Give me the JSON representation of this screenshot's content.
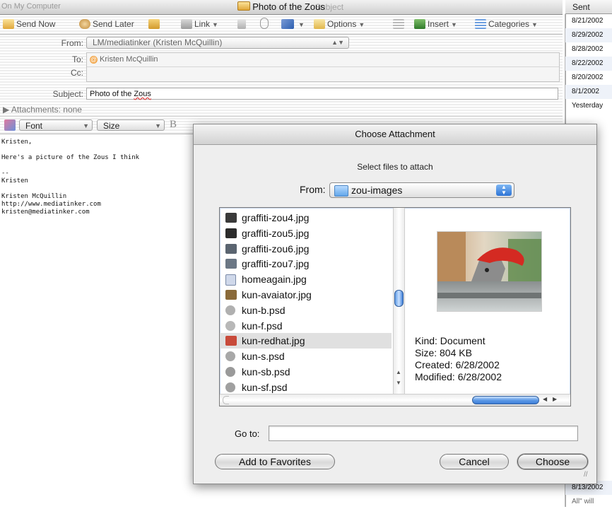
{
  "window": {
    "title": "Photo of the Zous",
    "ghost_left": "On My Computer",
    "ghost_right": "Subject"
  },
  "toolbar": {
    "send_now": "Send Now",
    "send_later": "Send Later",
    "link": "Link",
    "options": "Options",
    "insert": "Insert",
    "categories": "Categories"
  },
  "header": {
    "from_label": "From:",
    "from_value": "LM/mediatinker (Kristen McQuillin)",
    "to_label": "To:",
    "to_value": "Kristen McQuillin",
    "cc_label": "Cc:",
    "subject_label": "Subject:",
    "subject_value_pre": "Photo of the ",
    "subject_value_word": "Zous",
    "attachments_label": "▶ Attachments:",
    "attachments_value": "none"
  },
  "format_bar": {
    "font": "Font",
    "size": "Size",
    "bold": "B"
  },
  "message_body": "Kristen,\n\nHere's a picture of the Zous I think\n\n--\nKristen\n\nKristen McQuillin\nhttp://www.mediatinker.com\nkristen@mediatinker.com",
  "sent_column": {
    "header": "Sent",
    "dates": [
      "8/21/2002",
      "8/29/2002",
      "8/28/2002",
      "8/22/2002",
      "8/20/2002",
      "8/1/2002",
      "Yesterday"
    ],
    "bottom_date": "8/13/2002",
    "bottom_text": "All\" will"
  },
  "dialog": {
    "title": "Choose Attachment",
    "prompt": "Select files to attach",
    "from_label": "From:",
    "folder": "zou-images",
    "files": [
      {
        "name": "graffiti-zou4.jpg",
        "icon": "photo-icon",
        "color": "#3a3a3a"
      },
      {
        "name": "graffiti-zou5.jpg",
        "icon": "photo-icon",
        "color": "#2b2b2b"
      },
      {
        "name": "graffiti-zou6.jpg",
        "icon": "photo-icon",
        "color": "#5a6470"
      },
      {
        "name": "graffiti-zou7.jpg",
        "icon": "photo-icon",
        "color": "#6b7785"
      },
      {
        "name": "homeagain.jpg",
        "icon": "document-icon",
        "color": "#cfd8ea"
      },
      {
        "name": "kun-avaiator.jpg",
        "icon": "photo-icon",
        "color": "#8a6a3a"
      },
      {
        "name": "kun-b.psd",
        "icon": "psd-icon",
        "color": "#b0b0b0"
      },
      {
        "name": "kun-f.psd",
        "icon": "psd-icon",
        "color": "#b8b8b8"
      },
      {
        "name": "kun-redhat.jpg",
        "icon": "photo-icon",
        "color": "#c84a3a",
        "selected": true
      },
      {
        "name": "kun-s.psd",
        "icon": "psd-icon",
        "color": "#a8a8a8"
      },
      {
        "name": "kun-sb.psd",
        "icon": "psd-icon",
        "color": "#9a9a9a"
      },
      {
        "name": "kun-sf.psd",
        "icon": "psd-icon",
        "color": "#a0a0a0"
      }
    ],
    "preview": {
      "kind": "Kind: Document",
      "size": "Size: 804 KB",
      "created": "Created: 6/28/2002",
      "modified": "Modified: 6/28/2002"
    },
    "goto_label": "Go to:",
    "goto_value": "",
    "add_favorites": "Add to Favorites",
    "cancel": "Cancel",
    "choose": "Choose"
  }
}
